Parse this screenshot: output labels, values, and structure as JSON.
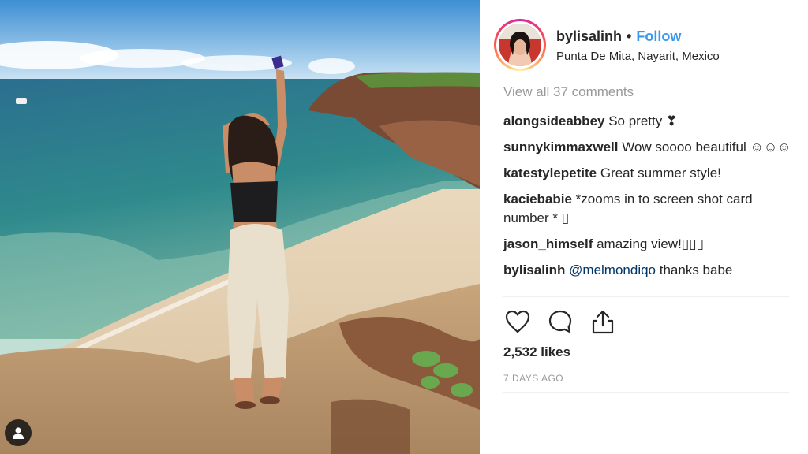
{
  "post": {
    "username": "bylisalinh",
    "separator": "•",
    "follow_label": "Follow",
    "location": "Punta De Mita, Nayarit, Mexico"
  },
  "comments": {
    "view_all_label": "View all 37 comments",
    "items": [
      {
        "user": "alongsideabbey",
        "text": " So pretty ❣"
      },
      {
        "user": "sunnykimmaxwell",
        "text": " Wow soooo beautiful ☺☺☺"
      },
      {
        "user": "katestylepetite",
        "text": " Great summer style!"
      },
      {
        "user": "kaciebabie",
        "text": " *zooms in to screen shot card number * ▯"
      },
      {
        "user": "jason_himself",
        "text": " amazing view!▯▯▯"
      },
      {
        "user": "bylisalinh",
        "mention": " @melmondiqo",
        "text": " thanks babe"
      }
    ]
  },
  "stats": {
    "likes": "2,532 likes",
    "time": "7 DAYS AGO"
  },
  "icons": {
    "like": "heart-icon",
    "comment": "comment-bubble-icon",
    "share": "share-icon",
    "tag": "user-tag-icon"
  },
  "colors": {
    "follow": "#3897f0",
    "muted": "#999999",
    "text": "#262626",
    "mention": "#003569"
  }
}
